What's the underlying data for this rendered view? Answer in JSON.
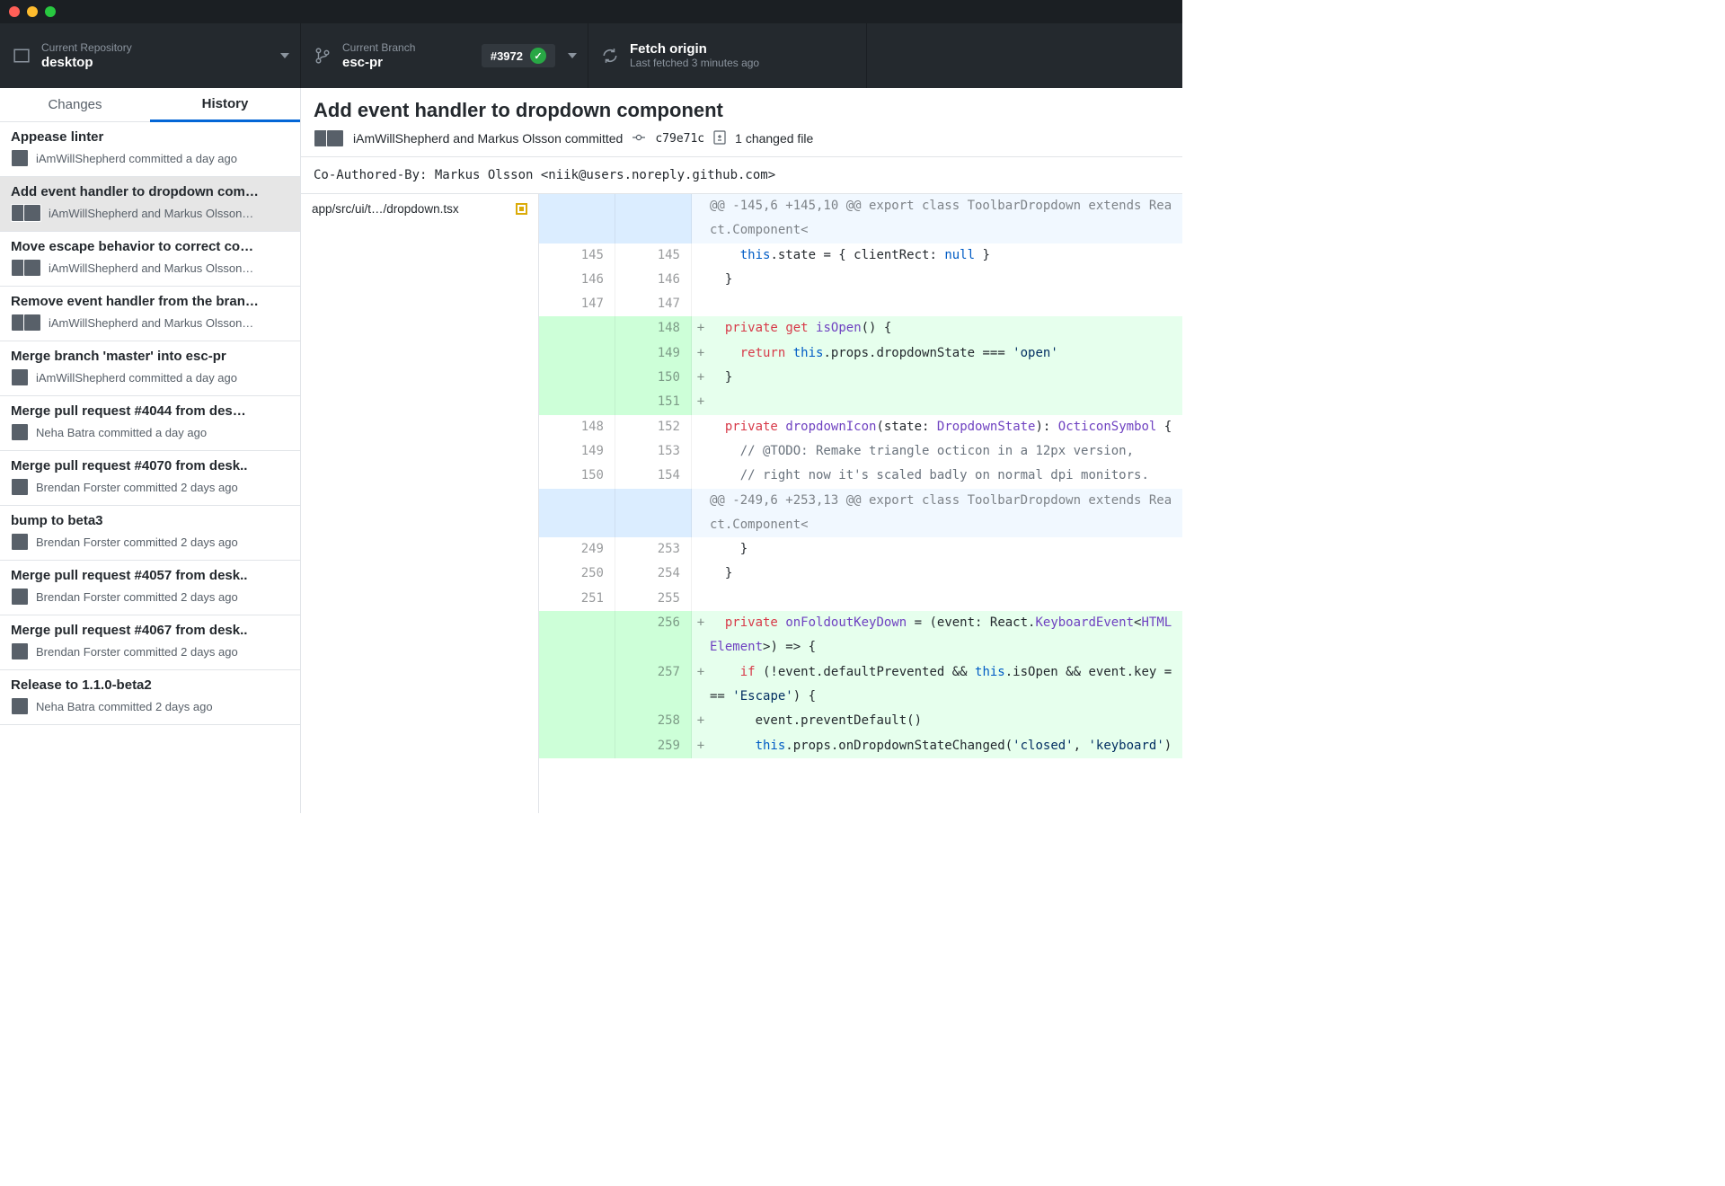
{
  "toolbar": {
    "repo": {
      "label": "Current Repository",
      "value": "desktop"
    },
    "branch": {
      "label": "Current Branch",
      "value": "esc-pr",
      "badge": "#3972"
    },
    "fetch": {
      "label": "Fetch origin",
      "sub": "Last fetched 3 minutes ago"
    }
  },
  "tabs": {
    "changes": "Changes",
    "history": "History"
  },
  "history": [
    {
      "title": "Appease linter",
      "meta": "iAmWillShepherd committed a day ago",
      "avatars": 1
    },
    {
      "title": "Add event handler to dropdown com…",
      "meta": "iAmWillShepherd and Markus Olsson…",
      "avatars": 2,
      "selected": true
    },
    {
      "title": "Move escape behavior to correct co…",
      "meta": "iAmWillShepherd and Markus Olsson…",
      "avatars": 2
    },
    {
      "title": "Remove event handler from the bran…",
      "meta": "iAmWillShepherd and Markus Olsson…",
      "avatars": 2
    },
    {
      "title": "Merge branch 'master' into esc-pr",
      "meta": "iAmWillShepherd committed a day ago",
      "avatars": 1
    },
    {
      "title": "Merge pull request #4044 from des…",
      "meta": "Neha Batra committed a day ago",
      "avatars": 1
    },
    {
      "title": "Merge pull request #4070 from desk..",
      "meta": "Brendan Forster committed 2 days ago",
      "avatars": 1
    },
    {
      "title": "bump to beta3",
      "meta": "Brendan Forster committed 2 days ago",
      "avatars": 1
    },
    {
      "title": "Merge pull request #4057 from desk..",
      "meta": "Brendan Forster committed 2 days ago",
      "avatars": 1
    },
    {
      "title": "Merge pull request #4067 from desk..",
      "meta": "Brendan Forster committed 2 days ago",
      "avatars": 1
    },
    {
      "title": "Release to 1.1.0-beta2",
      "meta": "Neha Batra committed 2 days ago",
      "avatars": 1
    }
  ],
  "commit": {
    "title": "Add event handler to dropdown component",
    "author_line": "iAmWillShepherd and Markus Olsson committed",
    "sha": "c79e71c",
    "changed": "1 changed file",
    "desc": "Co-Authored-By: Markus Olsson <niik@users.noreply.github.com>"
  },
  "file": {
    "path": "app/src/ui/t…/dropdown.tsx"
  },
  "diff": [
    {
      "type": "hunk",
      "text": "@@ -145,6 +145,10 @@ export class ToolbarDropdown extends React.Component<"
    },
    {
      "type": "ctx",
      "old": "145",
      "new": "145",
      "html": "    <span class='kw2'>this</span>.state = { clientRect: <span class='kw2'>null</span> }"
    },
    {
      "type": "ctx",
      "old": "146",
      "new": "146",
      "html": "  }"
    },
    {
      "type": "ctx",
      "old": "147",
      "new": "147",
      "html": " "
    },
    {
      "type": "add",
      "new": "148",
      "html": "  <span class='kw'>private</span> <span class='kw'>get</span> <span class='ident'>isOpen</span>() {"
    },
    {
      "type": "add",
      "new": "149",
      "html": "    <span class='kw'>return</span> <span class='kw2'>this</span>.props.dropdownState === <span class='str'>'open'</span>"
    },
    {
      "type": "add",
      "new": "150",
      "html": "  }"
    },
    {
      "type": "add",
      "new": "151",
      "html": ""
    },
    {
      "type": "ctx",
      "old": "148",
      "new": "152",
      "html": "  <span class='kw'>private</span> <span class='ident'>dropdownIcon</span>(state: <span class='ident'>DropdownState</span>): <span class='ident'>OcticonSymbol</span> {"
    },
    {
      "type": "ctx",
      "old": "149",
      "new": "153",
      "html": "    <span class='cmt'>// @TODO: Remake triangle octicon in a 12px version,</span>"
    },
    {
      "type": "ctx",
      "old": "150",
      "new": "154",
      "html": "    <span class='cmt'>// right now it's scaled badly on normal dpi monitors.</span>"
    },
    {
      "type": "hunk",
      "text": "@@ -249,6 +253,13 @@ export class ToolbarDropdown extends React.Component<"
    },
    {
      "type": "ctx",
      "old": "249",
      "new": "253",
      "html": "    }"
    },
    {
      "type": "ctx",
      "old": "250",
      "new": "254",
      "html": "  }"
    },
    {
      "type": "ctx",
      "old": "251",
      "new": "255",
      "html": " "
    },
    {
      "type": "add",
      "new": "256",
      "html": "  <span class='kw'>private</span> <span class='ident'>onFoldoutKeyDown</span> = (event: React.<span class='ident'>KeyboardEvent</span>&lt;<span class='ident'>HTMLElement</span>&gt;) =&gt; {"
    },
    {
      "type": "add",
      "new": "257",
      "html": "    <span class='kw'>if</span> (!event.defaultPrevented &amp;&amp; <span class='kw2'>this</span>.isOpen &amp;&amp; event.key === <span class='str'>'Escape'</span>) {"
    },
    {
      "type": "add",
      "new": "258",
      "html": "      event.preventDefault()"
    },
    {
      "type": "add",
      "new": "259",
      "html": "      <span class='kw2'>this</span>.props.onDropdownStateChanged(<span class='str'>'closed'</span>, <span class='str'>'keyboard'</span>)"
    }
  ]
}
